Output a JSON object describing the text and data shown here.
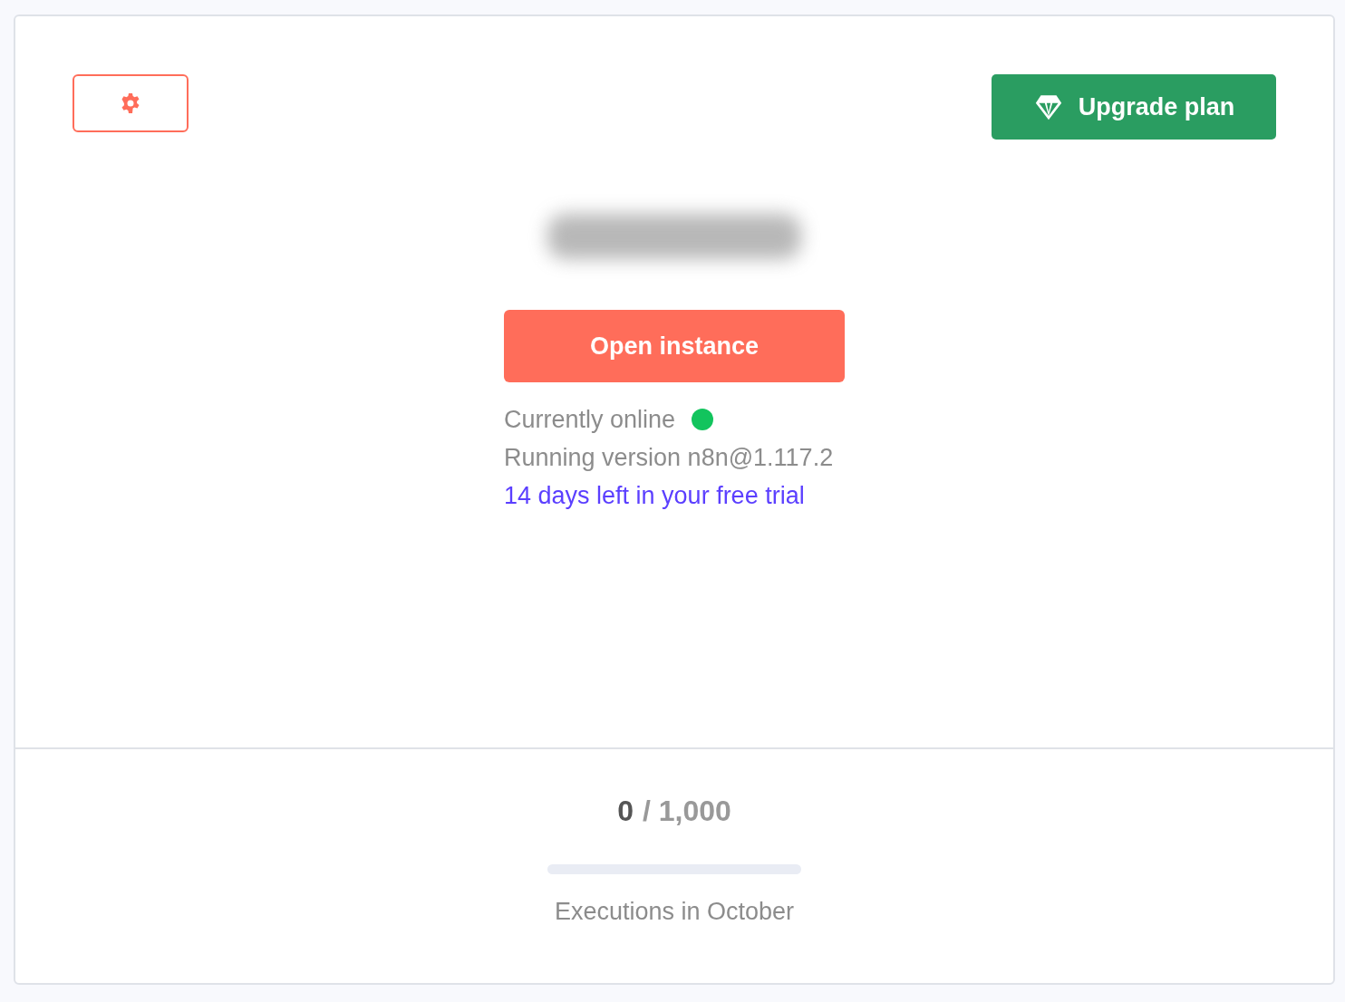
{
  "settings_button": {
    "kind": "gear"
  },
  "upgrade_button": {
    "label": "Upgrade plan"
  },
  "instance_name": {
    "kind": "redacted"
  },
  "open_button": {
    "label": "Open instance"
  },
  "status": {
    "text": "Currently online",
    "online": true,
    "color": "#12c45d"
  },
  "version": "Running version n8n@1.117.2",
  "trial": "14 days left in your free trial",
  "usage": {
    "used": "0",
    "limit": "/ 1,000",
    "level": 0,
    "caption": "Executions in October"
  }
}
